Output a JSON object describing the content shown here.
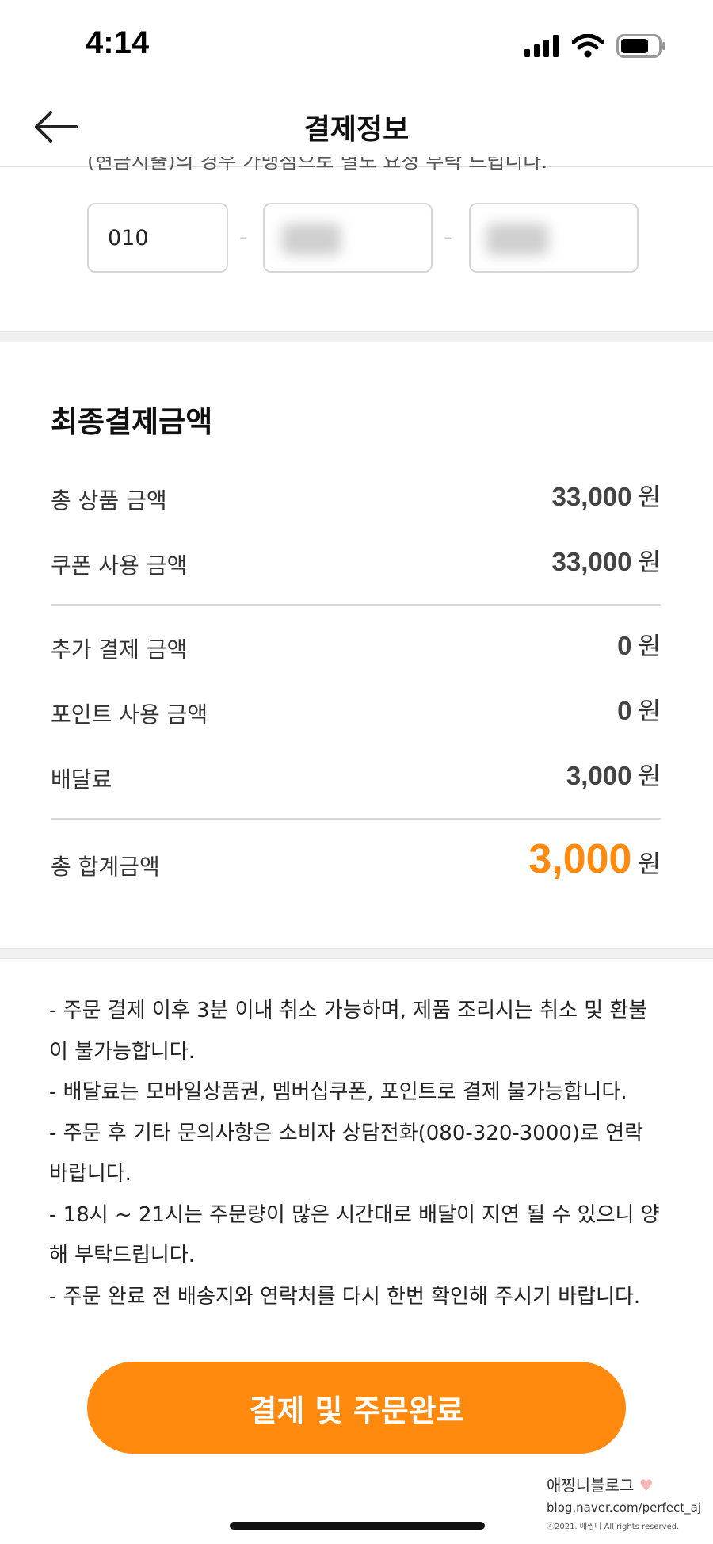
{
  "status_bar": {
    "time": "4:14"
  },
  "header": {
    "title": "결제정보"
  },
  "phone": {
    "notice_cut": "(현금지출)의 경우 가맹점으로 별도 요청 부탁 드립니다.",
    "first": "010",
    "separator": "-"
  },
  "summary": {
    "title": "최종결제금액",
    "unit": "원",
    "rows": [
      {
        "label": "총 상품 금액",
        "value": "33,000"
      },
      {
        "label": "쿠폰 사용 금액",
        "value": "33,000"
      },
      {
        "label": "추가 결제 금액",
        "value": "0"
      },
      {
        "label": "포인트 사용 금액",
        "value": "0"
      },
      {
        "label": "배달료",
        "value": "3,000"
      }
    ],
    "total": {
      "label": "총 합계금액",
      "value": "3,000"
    },
    "total_color": "#ff8a0d"
  },
  "notes": [
    "- 주문 결제 이후 3분 이내 취소 가능하며, 제품 조리시는 취소 및 환불",
    "이 불가능합니다.",
    "- 배달료는 모바일상품권, 멤버십쿠폰, 포인트로 결제 불가능합니다.",
    "- 주문 후 기타 문의사항은 소비자 상담전화(080-320-3000)로 연락",
    "바랍니다.",
    "- 18시 ~ 21시는 주문량이 많은 시간대로 배달이 지연 될 수 있으니 양",
    "해 부탁드립니다.",
    "- 주문 완료 전 배송지와 연락처를 다시 한번 확인해 주시기 바랍니다."
  ],
  "cta": {
    "label": "결제 및 주문완료"
  },
  "watermark": {
    "name": "애찡니블로그",
    "url": "blog.naver.com/perfect_aj",
    "copyright": "ⓒ2021. 애찡니 All rights reserved."
  },
  "colors": {
    "accent": "#ff8a0d"
  }
}
